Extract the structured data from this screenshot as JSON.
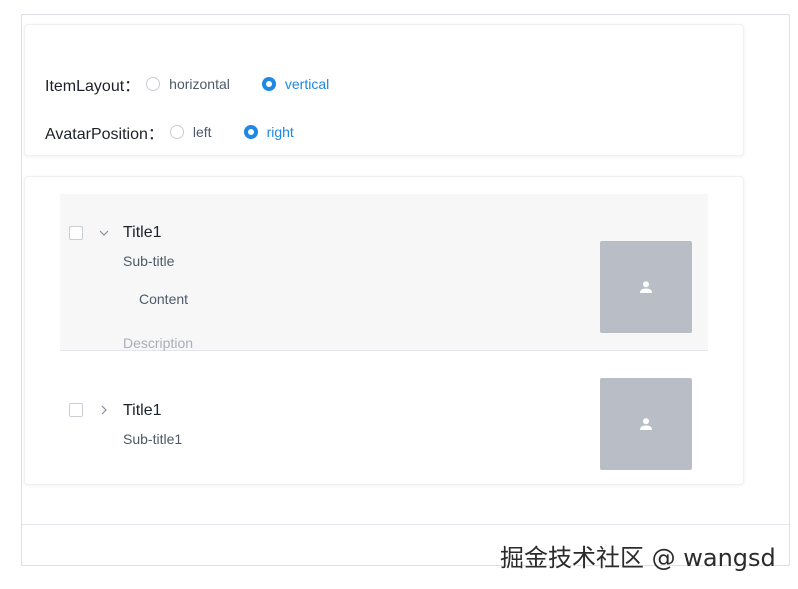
{
  "options": {
    "item_layout": {
      "label": "ItemLayout：",
      "choices": [
        {
          "label": "horizontal",
          "checked": false
        },
        {
          "label": "vertical",
          "checked": true
        }
      ]
    },
    "avatar_position": {
      "label": "AvatarPosition：",
      "choices": [
        {
          "label": "left",
          "checked": false
        },
        {
          "label": "right",
          "checked": true
        }
      ]
    }
  },
  "list": {
    "items": [
      {
        "title": "Title1",
        "subtitle": "Sub-title",
        "content": "Content",
        "description": "Description",
        "expanded": true,
        "checked": false,
        "avatar_icon": "user-icon"
      },
      {
        "title": "Title1",
        "subtitle": "Sub-title1",
        "expanded": false,
        "checked": false,
        "avatar_icon": "user-icon"
      }
    ]
  },
  "watermark": "掘金技术社区 @ wangsd",
  "colors": {
    "accent": "#1e88e5",
    "avatar_bg": "#b9bec6",
    "selected_row_bg": "#f7f7f8"
  }
}
